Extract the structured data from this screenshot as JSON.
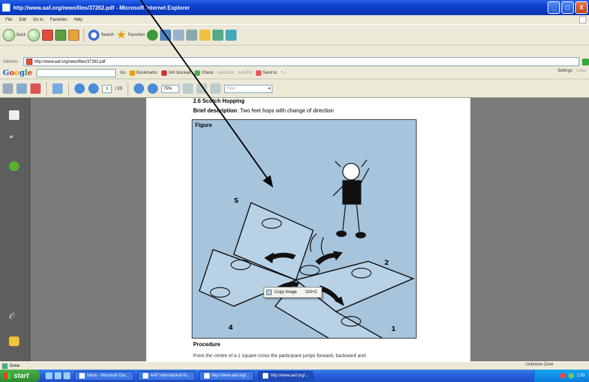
{
  "window": {
    "title": "http://www.aaf.org/newsfiles/37262.pdf - Microsoft Internet Explorer",
    "controls": [
      "_",
      "□",
      "X"
    ]
  },
  "menu": [
    "File",
    "Edit",
    "Go to",
    "Favorites",
    "Help"
  ],
  "toolbar": {
    "back_label": "Back",
    "search_label": "Search",
    "favorites_label": "Favorites"
  },
  "address": {
    "label": "Address",
    "url": "http://www.aaf.org/newsfiles/37262.pdf"
  },
  "google_bar": {
    "logo": [
      "G",
      "o",
      "o",
      "g",
      "l",
      "e"
    ],
    "go_label": "Go",
    "bookmarks_label": "Bookmarks",
    "popups_label": "340 blocked",
    "check_label": "Check",
    "autolink_label": "AutoLink",
    "autofill_label": "AutoFill",
    "sendto_label": "Send to",
    "settings_label": "Settings",
    "links_label": "Links"
  },
  "pdf_toolbar": {
    "page_current": "1",
    "page_total": "/ 23",
    "zoom": "75%",
    "find_placeholder": "Find"
  },
  "document": {
    "section_title": "2.6 Scotch Hopping",
    "brief_label": "Brief description",
    "brief_text": ": Two feet hops with change of direction",
    "figure_label": "Figure",
    "procedure_label": "Procedure",
    "procedure_text": "From the centre of a 1 square cross the participant jumps forward, backward and"
  },
  "context_menu": {
    "item_label": "Copy Image",
    "shortcut": "Ctrl+C"
  },
  "status": {
    "text": "Done",
    "zone": "Unknown Zone"
  },
  "taskbar": {
    "start_label": "start",
    "tasks": [
      "Inbox - Microsoft Out...",
      "AAF International fo...",
      "http://www.aaf.org/...",
      "http://www.aaf.org/..."
    ],
    "clock": "1:33"
  },
  "colors": {
    "titlebar": "#0a3fcf",
    "figure_bg": "#a6c4dc",
    "viewer_bg": "#7b7b7b",
    "start_green": "#2f8a2f"
  }
}
